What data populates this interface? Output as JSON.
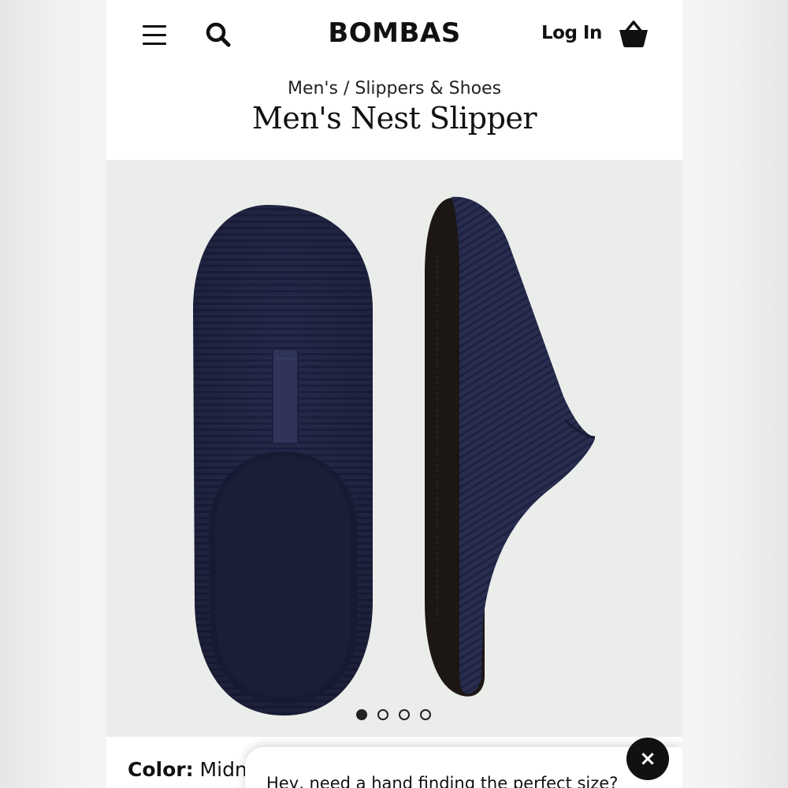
{
  "header": {
    "menu_icon": "hamburger-menu-icon",
    "search_icon": "search-icon",
    "logo": "BOMBAS",
    "login_label": "Log In",
    "cart_icon": "shopping-basket-icon"
  },
  "breadcrumb": {
    "category": "Men's",
    "separator": " / ",
    "subcategory": "Slippers & Shoes"
  },
  "product": {
    "title": "Men's Nest Slipper",
    "color_label": "Color:",
    "color_value": "Midni"
  },
  "gallery": {
    "slide_count": 4,
    "active_slide": 1,
    "background": "#ebedea",
    "slipper_color": "#262a4a"
  },
  "chat": {
    "message": "Hey, need a hand finding the perfect size?",
    "close_icon": "close-icon",
    "close_glyph": "×"
  }
}
